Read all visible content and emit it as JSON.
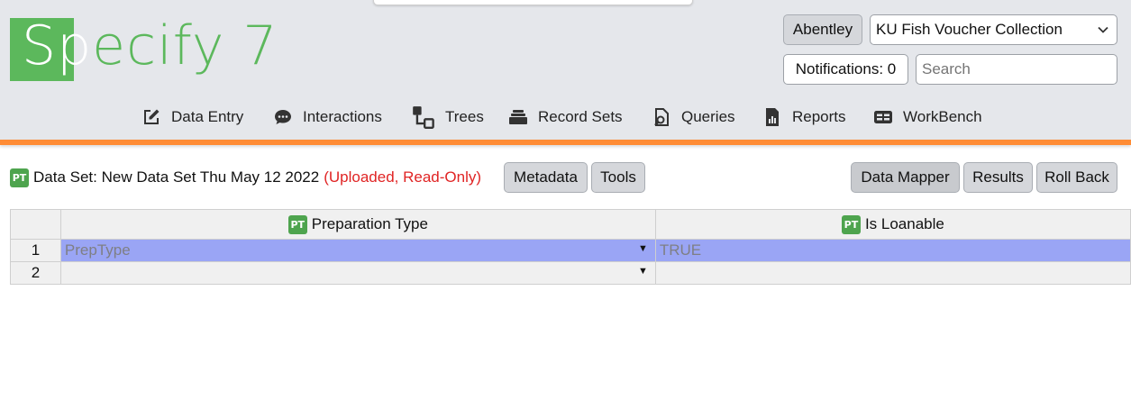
{
  "app": {
    "logo_text_first": "Sp",
    "logo_text_rest": "ecify 7",
    "user_button": "Abentley",
    "collection_select": "KU Fish Voucher Collection",
    "notifications_label": "Notifications: 0",
    "search_placeholder": "Search"
  },
  "nav": {
    "items": [
      {
        "label": "Data Entry",
        "icon": "pencil-square-icon"
      },
      {
        "label": "Interactions",
        "icon": "chat-bubble-icon"
      },
      {
        "label": "Trees",
        "icon": "tree-nodes-icon"
      },
      {
        "label": "Record Sets",
        "icon": "stacked-trays-icon"
      },
      {
        "label": "Queries",
        "icon": "document-search-icon"
      },
      {
        "label": "Reports",
        "icon": "report-chart-icon"
      },
      {
        "label": "WorkBench",
        "icon": "table-card-icon"
      }
    ]
  },
  "dataset": {
    "badge": "PT",
    "title": "Data Set: New Data Set Thu May 12 2022",
    "status": "(Uploaded, Read-Only)",
    "buttons": {
      "metadata": "Metadata",
      "tools": "Tools",
      "data_mapper": "Data Mapper",
      "results": "Results",
      "roll_back": "Roll Back"
    }
  },
  "grid": {
    "columns": [
      {
        "badge": "PT",
        "label": "Preparation Type"
      },
      {
        "badge": "PT",
        "label": "Is Loanable"
      }
    ],
    "rows": [
      {
        "num": "1",
        "cells": [
          "PrepType",
          "TRUE"
        ]
      },
      {
        "num": "2",
        "cells": [
          "",
          ""
        ]
      }
    ]
  },
  "colors": {
    "brand_green": "#5cb85c",
    "accent_orange": "#ff8c35",
    "selected_row": "#9aa5f5",
    "status_red": "#e02424"
  }
}
